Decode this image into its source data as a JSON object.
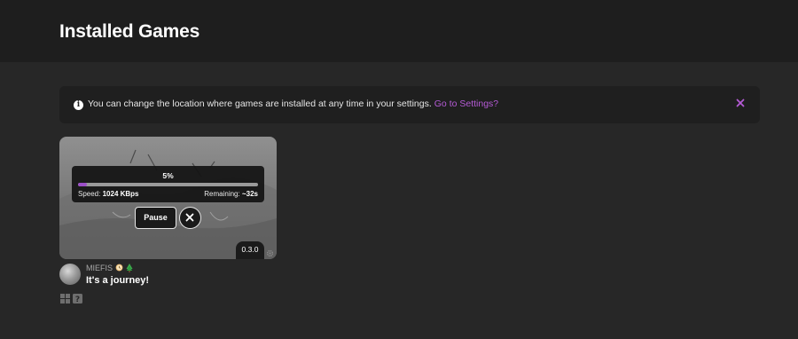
{
  "header": {
    "title": "Installed Games"
  },
  "notice": {
    "icon": "info-icon",
    "text": "You can change the location where games are installed at any time in your settings.",
    "link_text": "Go to Settings?",
    "close_icon": "close-icon",
    "link_color": "#b55bd6"
  },
  "game_card": {
    "download": {
      "percent_label": "5%",
      "progress": 0.05,
      "speed_label": "Speed:",
      "speed_value": "1024 KBps",
      "remaining_label": "Remaining:",
      "remaining_value": "~32s",
      "progress_color": "#9c4fc8"
    },
    "pause_label": "Pause",
    "cancel_icon": "close-icon",
    "version": "0.3.0",
    "settings_icon": "gear-icon",
    "author": "MIEFIS",
    "author_badges": [
      "clock-icon",
      "tree-icon"
    ],
    "title": "It's a journey!",
    "platforms": [
      "windows-icon",
      "unknown-os-icon"
    ]
  }
}
